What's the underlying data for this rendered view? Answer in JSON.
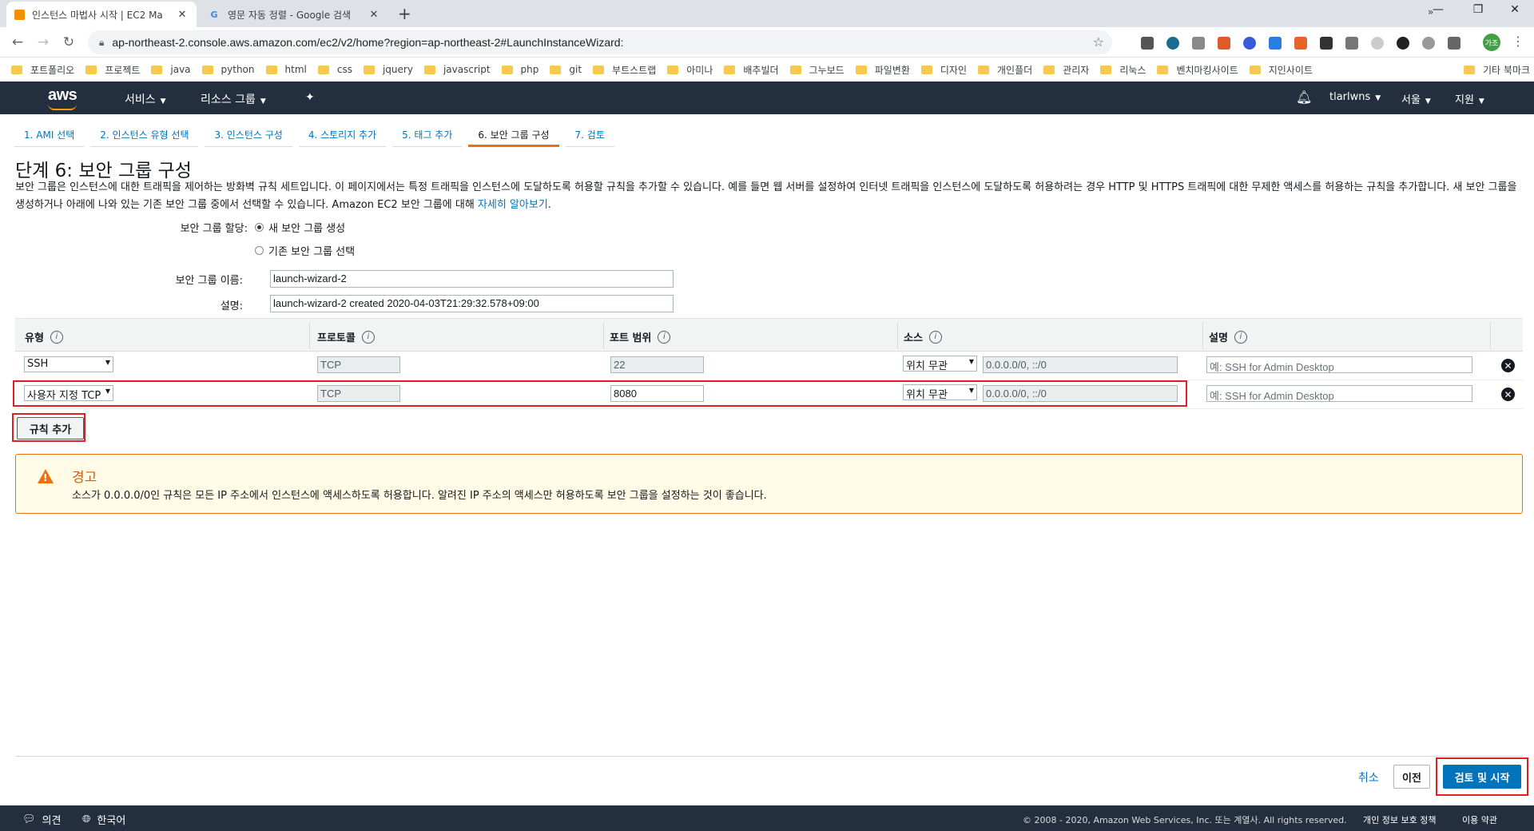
{
  "browser": {
    "tabs": [
      {
        "title": "인스턴스 마법사 시작 | EC2 Ma",
        "active": true
      },
      {
        "title": "영문 자동 정렬 - Google 검색",
        "active": false
      }
    ],
    "url": "ap-northeast-2.console.aws.amazon.com/ec2/v2/home?region=ap-northeast-2#LaunchInstanceWizard:",
    "profile_initials": "가조",
    "bookmarks": [
      "포트폴리오",
      "프로젝트",
      "java",
      "python",
      "html",
      "css",
      "jquery",
      "javascript",
      "php",
      "git",
      "부트스트랩",
      "아미나",
      "배추빌더",
      "그누보드",
      "파일변환",
      "디자인",
      "개인플더",
      "관리자",
      "리눅스",
      "벤치마킹사이트",
      "지인사이트"
    ],
    "bookmarks_more": "»",
    "bookmarks_other": "기타 북마크"
  },
  "aws_nav": {
    "logo": "aws",
    "services": "서비스",
    "resource_groups": "리소스 그룹",
    "user": "tlarlwns",
    "region": "서울",
    "support": "지원"
  },
  "wizard_steps": [
    "1. AMI 선택",
    "2. 인스턴스 유형 선택",
    "3. 인스턴스 구성",
    "4. 스토리지 추가",
    "5. 태그 추가",
    "6. 보안 그룹 구성",
    "7. 검토"
  ],
  "page": {
    "title": "단계 6: 보안 그룹 구성",
    "intro": "보안 그룹은 인스턴스에 대한 트래픽을 제어하는 방화벽 규칙 세트입니다. 이 페이지에서는 특정 트래픽을 인스턴스에 도달하도록 허용할 규칙을 추가할 수 있습니다. 예를 들면 웹 서버를 설정하여 인터넷 트래픽을 인스턴스에 도달하도록 허용하려는 경우 HTTP 및 HTTPS 트래픽에 대한 무제한 액세스를 허용하는 규칙을 추가합니다. 새 보안 그룹을 생성하거나 아래에 나와 있는 기존 보안 그룹 중에서 선택할 수 있습니다. Amazon EC2 보안 그룹에 대해 ",
    "learn_more": "자세히 알아보기",
    "intro_end": "."
  },
  "form": {
    "assign_label": "보안 그룹 할당:",
    "option_new": "새 보안 그룹 생성",
    "option_existing": "기존 보안 그룹 선택",
    "name_label": "보안 그룹 이름:",
    "name_value": "launch-wizard-2",
    "desc_label": "설명:",
    "desc_value": "launch-wizard-2 created 2020-04-03T21:29:32.578+09:00"
  },
  "rules_table": {
    "headers": [
      "유형",
      "프로토콜",
      "포트 범위",
      "소스",
      "설명"
    ],
    "info_glyph": "i",
    "rows": [
      {
        "type": "SSH",
        "protocol": "TCP",
        "port": "22",
        "source_mode": "위치 무관",
        "source_cidr": "0.0.0.0/0, ::/0",
        "description_placeholder": "예: SSH for Admin Desktop"
      },
      {
        "type": "사용자 지정 TCP",
        "protocol": "TCP",
        "port": "8080",
        "source_mode": "위치 무관",
        "source_cidr": "0.0.0.0/0, ::/0",
        "description_placeholder": "예: SSH for Admin Desktop"
      }
    ],
    "add_rule": "규칙 추가"
  },
  "warning": {
    "title": "경고",
    "message": "소스가 0.0.0.0/0인 규칙은 모든 IP 주소에서 인스턴스에 액세스하도록 허용합니다. 알려진 IP 주소의 액세스만 허용하도록 보안 그룹을 설정하는 것이 좋습니다."
  },
  "actions": {
    "cancel": "취소",
    "previous": "이전",
    "review_launch": "검토 및 시작"
  },
  "footer": {
    "feedback": "의견",
    "language": "한국어",
    "copyright": "© 2008 - 2020, Amazon Web Services, Inc. 또는 계열사. All rights reserved.",
    "privacy": "개인 정보 보호 정책",
    "terms": "이용 약관"
  },
  "colors": {
    "aws_nav_bg": "#232f3e",
    "aws_orange": "#ff9900",
    "link_blue": "#0073bb",
    "warning_orange": "#ec7211",
    "highlight_red": "#e02020"
  }
}
